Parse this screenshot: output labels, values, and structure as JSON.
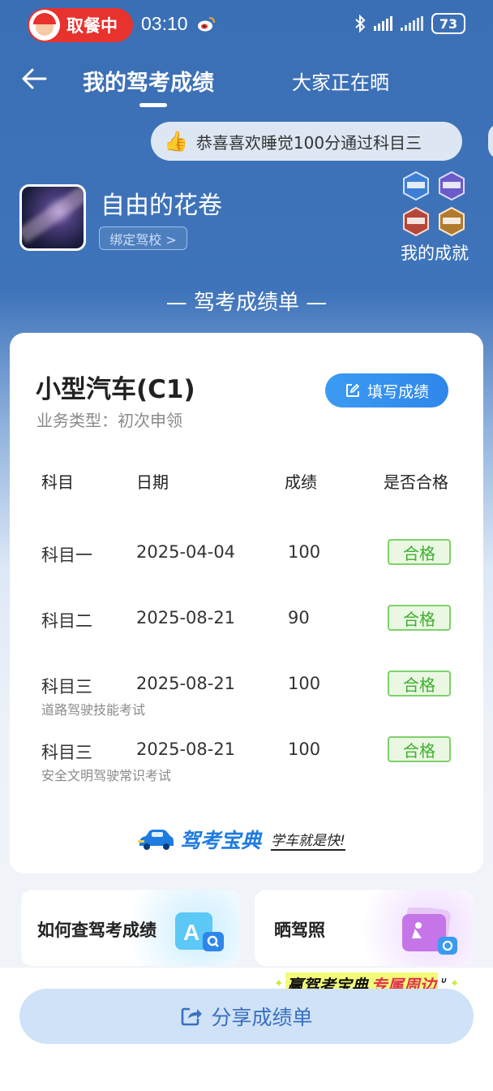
{
  "status_bar": {
    "order_pill": "取餐中",
    "time": "03:10",
    "battery": "73"
  },
  "header": {
    "active_tab": "我的驾考成绩",
    "other_tab": "大家正在晒"
  },
  "congrats_banner": "恭喜喜欢睡觉100分通过科目三",
  "profile": {
    "name": "自由的花卷",
    "bind_school": "绑定驾校 >",
    "achievements_label": "我的成就"
  },
  "section_title": "— 驾考成绩单 —",
  "card": {
    "car_type": "小型汽车(C1)",
    "business_type": "业务类型：初次申领",
    "fill_button": "填写成绩",
    "columns": [
      "科目",
      "日期",
      "成绩",
      "是否合格"
    ],
    "rows": [
      {
        "subject": "科目一",
        "date": "2025-04-04",
        "score": "100",
        "result": "合格",
        "note": ""
      },
      {
        "subject": "科目二",
        "date": "2025-08-21",
        "score": "90",
        "result": "合格",
        "note": ""
      },
      {
        "subject": "科目三",
        "date": "2025-08-21",
        "score": "100",
        "result": "合格",
        "note": "道路驾驶技能考试"
      },
      {
        "subject": "科目三",
        "date": "2025-08-21",
        "score": "100",
        "result": "合格",
        "note": "安全文明驾驶常识考试"
      }
    ],
    "brand_name": "驾考宝典",
    "brand_slogan": "学车就是快!"
  },
  "tiles": {
    "left": "如何查驾考成绩",
    "right": "晒驾照"
  },
  "promo": {
    "part1": "赢驾考宝典",
    "part2": "专属周边"
  },
  "share_button": "分享成绩单",
  "colors": {
    "header_blue": "#3b6fb5",
    "pass_green": "#3fae2f",
    "accent_blue": "#2f86ea",
    "order_red": "#e8322e"
  }
}
